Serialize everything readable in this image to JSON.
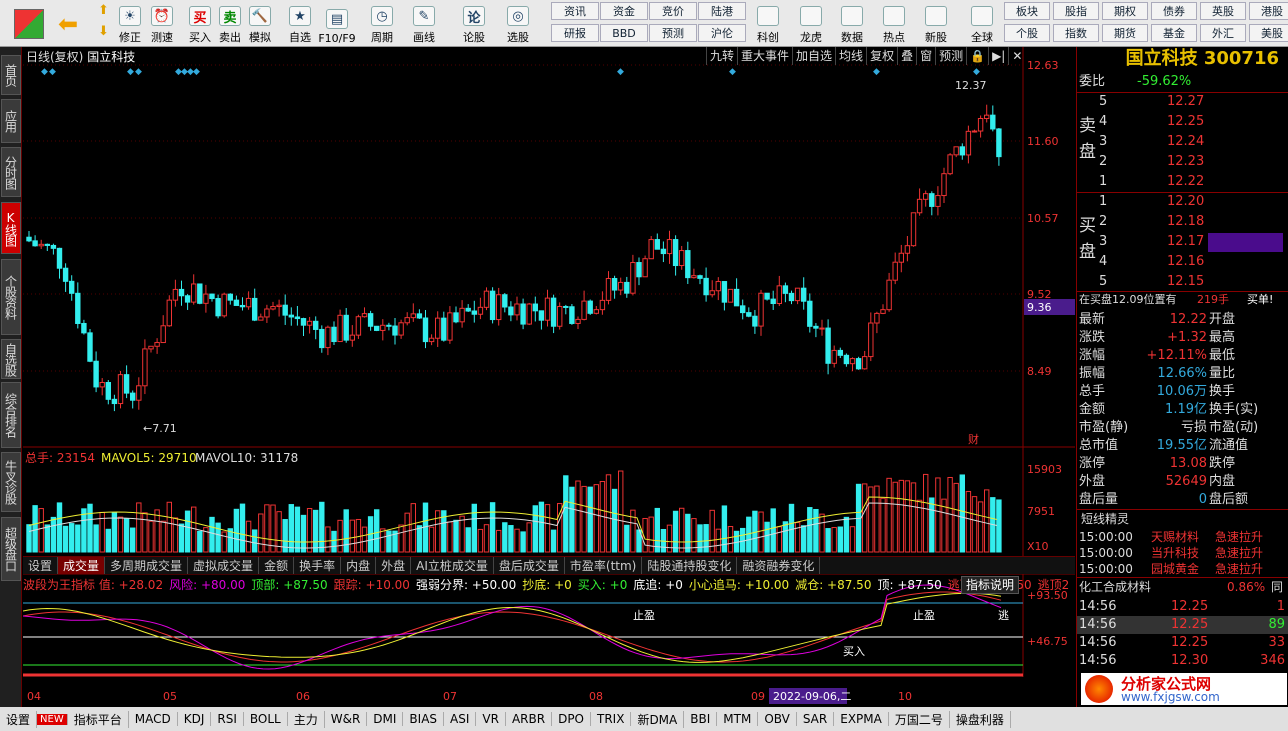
{
  "toolbar": {
    "big": [
      {
        "label": "修正"
      },
      {
        "label": "测速"
      },
      {
        "label": "买入"
      },
      {
        "label": "卖出"
      },
      {
        "label": "模拟"
      },
      {
        "label": "自选"
      },
      {
        "label": "F10/F9"
      },
      {
        "label": "周期"
      },
      {
        "label": "画线"
      },
      {
        "label": "论股"
      },
      {
        "label": "选股"
      }
    ],
    "small_top": [
      "资讯",
      "资金",
      "竞价",
      "陆港"
    ],
    "small_bottom": [
      "研报",
      "BBD",
      "预测",
      "沪伦"
    ],
    "big2": [
      {
        "label": "科创"
      },
      {
        "label": "龙虎"
      },
      {
        "label": "数据"
      },
      {
        "label": "热点"
      },
      {
        "label": "新股"
      },
      {
        "label": "全球"
      }
    ],
    "right_top": [
      "板块",
      "股指",
      "期权",
      "债券",
      "英股",
      "港股"
    ],
    "right_bottom": [
      "个股",
      "指数",
      "期货",
      "基金",
      "外汇",
      "美股"
    ]
  },
  "sidebar": [
    "首页",
    "应用",
    "分时图",
    "K线图",
    "个股资料",
    "自选股",
    "综合排名",
    "牛叉诊股",
    "超级盘口"
  ],
  "chart": {
    "title": "日线(复权)",
    "stock": "国立科技",
    "tools": [
      "九转",
      "重大事件",
      "加自选",
      "均线",
      "复权",
      "叠",
      "窗",
      "预测"
    ],
    "y_labels": [
      "12.63",
      "11.60",
      "10.57",
      "9.52",
      "8.49"
    ],
    "current_price_tag": "9.36",
    "high_label": "12.37",
    "low_label": "7.71",
    "fin_label": "财",
    "vol_line": {
      "label1": "总手: 23154",
      "label2": "MAVOL5: 29710",
      "label3": "MAVOL10: 31178"
    },
    "vol_y": [
      "15903",
      "7951",
      "X10"
    ],
    "x_labels": [
      "04",
      "05",
      "06",
      "07",
      "08",
      "09",
      "10"
    ],
    "date_tag": "2022-09-06,二",
    "ind_y": [
      "+93.50",
      "+46.75"
    ],
    "ind_text": [
      {
        "t": "波段为王指标 值: +28.02",
        "c": "#e33"
      },
      {
        "t": "风险: +80.00",
        "c": "#d0d"
      },
      {
        "t": "顶部: +87.50",
        "c": "#3e3"
      },
      {
        "t": "跟踪: +10.00",
        "c": "#e33"
      },
      {
        "t": "强弱分界: +50.00",
        "c": "#fff"
      },
      {
        "t": "抄底: +0",
        "c": "#ee3"
      },
      {
        "t": "买入: +0",
        "c": "#3e3"
      },
      {
        "t": "底追: +0",
        "c": "#fff"
      },
      {
        "t": "小心追马: +10.00",
        "c": "#ee3"
      },
      {
        "t": "减仓: +87.50",
        "c": "#ee3"
      },
      {
        "t": "顶: +87.50",
        "c": "#fff"
      },
      {
        "t": "逃顶1: +87.50",
        "c": "#e33"
      },
      {
        "t": "逃顶2",
        "c": "#e33"
      }
    ],
    "ind_note": "指标说明",
    "ind_marks": [
      "止盈",
      "买入",
      "止盈",
      "逃"
    ]
  },
  "chart_data": {
    "type": "candlestick",
    "stock": "国立科技",
    "y_range": [
      7.5,
      12.8
    ]
  },
  "tabs": [
    "设置",
    "成交量",
    "多周期成交量",
    "虚拟成交量",
    "金额",
    "换手率",
    "内盘",
    "外盘",
    "AI立桩成交量",
    "盘后成交量",
    "市盈率(ttm)",
    "陆股通持股变化",
    "融资融券变化"
  ],
  "panel": {
    "title": "国立科技 300716",
    "weibi_label": "委比",
    "weibi_val": "-59.62%",
    "sell_label": [
      "卖",
      "盘"
    ],
    "buy_label": [
      "买",
      "盘"
    ],
    "sell": [
      [
        "5",
        "12.27"
      ],
      [
        "4",
        "12.25"
      ],
      [
        "3",
        "12.24"
      ],
      [
        "2",
        "12.23"
      ],
      [
        "1",
        "12.22"
      ]
    ],
    "buy": [
      [
        "1",
        "12.20"
      ],
      [
        "2",
        "12.18"
      ],
      [
        "3",
        "12.17"
      ],
      [
        "4",
        "12.16"
      ],
      [
        "5",
        "12.15"
      ]
    ],
    "notice": "在买盘12.09位置有",
    "notice_val": "219手",
    "notice_act": "买单!",
    "stats": [
      [
        "最新",
        "12.22",
        "开盘",
        ""
      ],
      [
        "涨跌",
        "+1.32",
        "最高",
        ""
      ],
      [
        "涨幅",
        "+12.11%",
        "最低",
        ""
      ],
      [
        "振幅",
        "12.66%",
        "量比",
        ""
      ],
      [
        "总手",
        "10.06万",
        "换手",
        ""
      ],
      [
        "金额",
        "1.19亿",
        "换手(实)",
        ""
      ],
      [
        "市盈(静)",
        "亏损",
        "市盈(动)",
        ""
      ],
      [
        "总市值",
        "19.55亿",
        "流通值",
        ""
      ],
      [
        "涨停",
        "13.08",
        "跌停",
        ""
      ],
      [
        "外盘",
        "52649",
        "内盘",
        ""
      ],
      [
        "盘后量",
        "0",
        "盘后额",
        ""
      ]
    ],
    "short_title": "短线精灵",
    "short": [
      [
        "15:00:00",
        "天赐材料",
        "急速拉升"
      ],
      [
        "15:00:00",
        "当升科技",
        "急速拉升"
      ],
      [
        "15:00:00",
        "园城黄金",
        "急速拉升"
      ]
    ],
    "sector": "化工合成材料",
    "sector_pct": "0.86%",
    "sector_more": "同",
    "ticks": [
      [
        "14:56",
        "12.25",
        "1"
      ],
      [
        "14:56",
        "12.25",
        "89"
      ],
      [
        "14:56",
        "12.25",
        "33"
      ],
      [
        "14:56",
        "12.30",
        "346"
      ]
    ],
    "brand": "分析家公式网",
    "brand_url": "www.fxjgsw.com"
  },
  "footer": [
    "设置",
    "NEW",
    "指标平台",
    "MACD",
    "KDJ",
    "RSI",
    "BOLL",
    "主力",
    "W&R",
    "DMI",
    "BIAS",
    "ASI",
    "VR",
    "ARBR",
    "DPO",
    "TRIX",
    "新DMA",
    "BBI",
    "MTM",
    "OBV",
    "SAR",
    "EXPMA",
    "万国二号",
    "操盘利器"
  ]
}
